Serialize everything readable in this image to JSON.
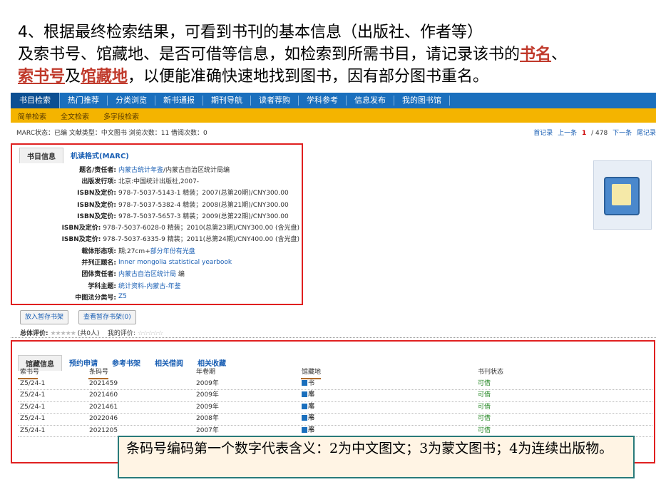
{
  "slide": {
    "line1": "4、根据最终检索结果，可看到书刊的基本信息（出版社、作者等）",
    "line2_pre": "及索书号、馆藏地、是否可借等信息，如检索到所需书目，请记录该书的",
    "hl_title": "书名",
    "line2_post": "、",
    "hl_callno": "索书号",
    "line3_mid": "及",
    "hl_location": "馆藏地",
    "line3_post": "，以便能准确快速地找到图书，因有部分图书重名。"
  },
  "nav_main": [
    "书目检索",
    "热门推荐",
    "分类浏览",
    "新书通报",
    "期刊导航",
    "读者荐购",
    "学科参考",
    "信息发布",
    "我的图书馆"
  ],
  "nav_sub": [
    "简单检索",
    "全文检索",
    "多字段检索"
  ],
  "status": {
    "left": "MARC状态：已编   文献类型：中文图书   浏览次数：11   借阅次数：0",
    "first": "首记录",
    "prev": "上一条",
    "current": "1",
    "sep": "/ 478",
    "next": "下一条",
    "last": "尾记录"
  },
  "detail_tabs": [
    "书目信息",
    "机读格式(MARC)"
  ],
  "info_rows": [
    {
      "k": "题名/责任者:",
      "v": "内蒙古统计年鉴",
      "v2": "/内蒙古自治区统计局编"
    },
    {
      "k": "出版发行项:",
      "v": "北京:中国统计出版社,2007-"
    },
    {
      "k": "ISBN及定价:",
      "v": "978-7-5037-5143-1 精装；2007(总第20期)/CNY300.00"
    },
    {
      "k": "ISBN及定价:",
      "v": "978-7-5037-5382-4 精装；2008(总第21期)/CNY300.00"
    },
    {
      "k": "ISBN及定价:",
      "v": "978-7-5037-5657-3 精装；2009(总第22期)/CNY300.00"
    },
    {
      "k": "ISBN及定价:",
      "v": "978-7-5037-6028-0 精装；2010(总第23期)/CNY300.00 (含光盘)"
    },
    {
      "k": "ISBN及定价:",
      "v": "978-7-5037-6335-9 精装；2011(总第24期)/CNY400.00 (含光盘)"
    },
    {
      "k": "载体形态项:",
      "v": "期;27cm+",
      "v2": "部分年份有光盘"
    },
    {
      "k": "并列正题名:",
      "v": "Inner mongolia statistical yearbook"
    },
    {
      "k": "团体责任者:",
      "v": "内蒙古自治区统计局",
      "v2": " 编"
    },
    {
      "k": "学科主题:",
      "v": "统计资料-内蒙古-年鉴"
    },
    {
      "k": "中图法分类号:",
      "v": "Z5"
    }
  ],
  "buttons": {
    "add_shelf": "放入暂存书架",
    "view_shelf": "查看暂存书架(0)"
  },
  "rating": {
    "label": "总体评价:",
    "count": "(共0人)",
    "mine": "我的评价:"
  },
  "holding_tabs": [
    "馆藏信息",
    "预约申请",
    "参考书架",
    "相关借阅",
    "相关收藏"
  ],
  "table": {
    "headers": [
      "索书号",
      "条码号",
      "年卷期",
      "馆藏地",
      "书刊状态"
    ],
    "rows": [
      [
        "Z5/24-1",
        "2021459",
        "2009年",
        "书库",
        "可借"
      ],
      [
        "Z5/24-1",
        "2021460",
        "2009年",
        "书库",
        "可借"
      ],
      [
        "Z5/24-1",
        "2021461",
        "2009年",
        "书库",
        "可借"
      ],
      [
        "Z5/24-1",
        "2022046",
        "2008年",
        "书库",
        "可借"
      ],
      [
        "Z5/24-1",
        "2021205",
        "2007年",
        "书库",
        "可借"
      ]
    ]
  },
  "callout": "条码号编码第一个数字代表含义：2为中文图文；3为蒙文图书；4为连续出版物。",
  "colors": {
    "nav": "#1a6fbd",
    "subnav": "#f4b400",
    "highlight": "#e02020",
    "callout_bg": "#fff4e4"
  }
}
